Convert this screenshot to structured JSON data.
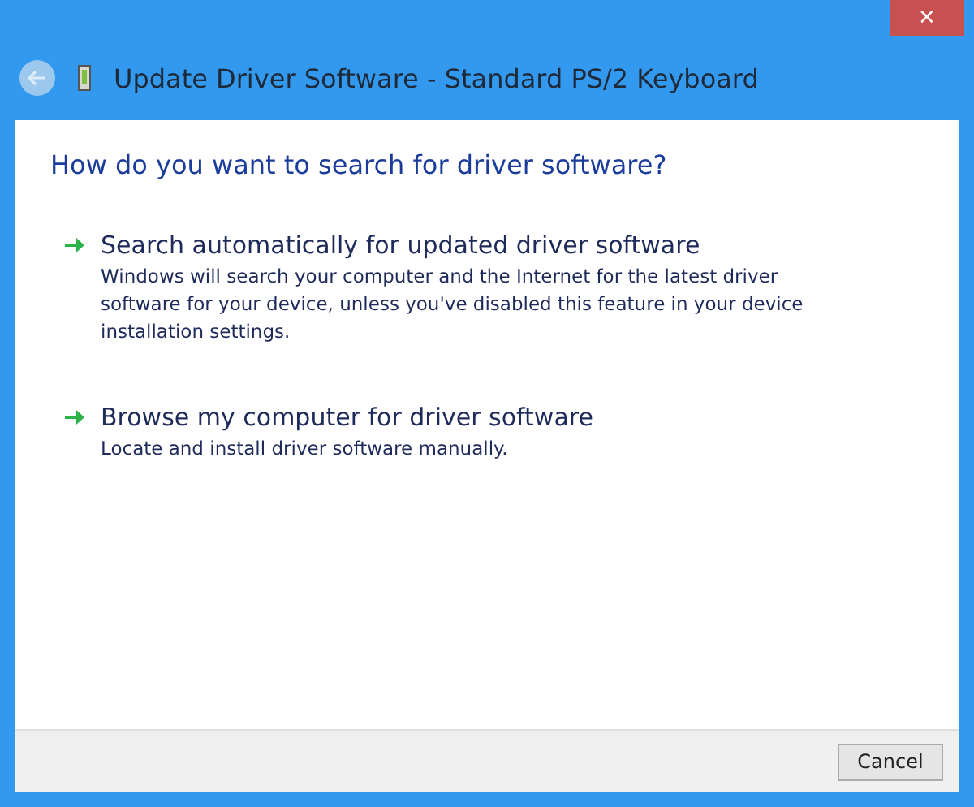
{
  "window": {
    "title": "Update Driver Software - Standard PS/2 Keyboard",
    "back_button": {
      "disabled": true
    },
    "close_button": {
      "label": "✕"
    }
  },
  "heading": "How do you want to search for driver software?",
  "options": [
    {
      "title": "Search automatically for updated driver software",
      "description": "Windows will search your computer and the Internet for the latest driver software for your device, unless you've disabled this feature in your device installation settings."
    },
    {
      "title": "Browse my computer for driver software",
      "description": "Locate and install driver software manually."
    }
  ],
  "buttons": [
    {
      "label": "Cancel"
    }
  ]
}
